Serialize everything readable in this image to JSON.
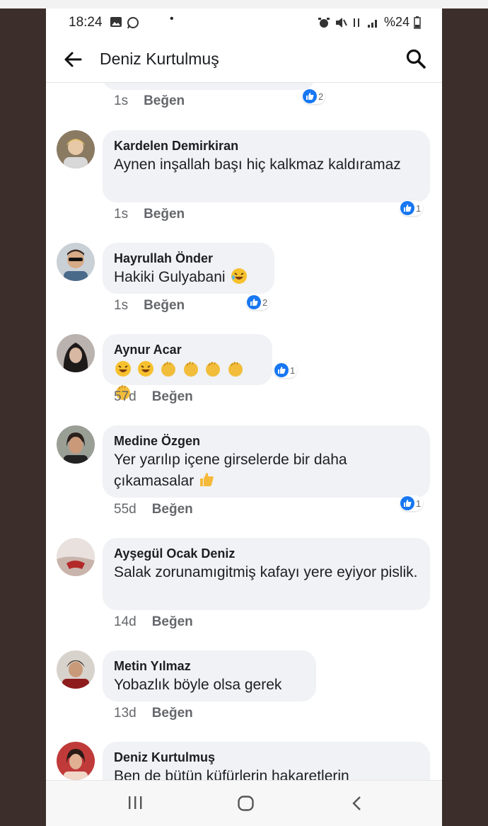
{
  "status_bar": {
    "time": "18:24",
    "battery": "%24"
  },
  "header": {
    "title": "Deniz Kurtulmuş"
  },
  "comments": [
    {
      "author": "",
      "text": "",
      "time": "1s",
      "like": "Beğen",
      "reactions": "2"
    },
    {
      "author": "Kardelen Demirkiran",
      "text": "Aynen inşallah başı hiç kalkmaz kaldıramaz",
      "time": "1s",
      "like": "Beğen",
      "reactions": "1"
    },
    {
      "author": "Hayrullah Önder",
      "text": "Hakiki Gulyabani",
      "time": "1s",
      "like": "Beğen",
      "reactions": "2"
    },
    {
      "author": "Aynur Acar",
      "text": "",
      "time": "57d",
      "like": "Beğen",
      "reactions": "1"
    },
    {
      "author": "Medine Özgen",
      "text": "Yer yarılıp içene girselerde bir daha çıkamasalar",
      "time": "55d",
      "like": "Beğen",
      "reactions": "1"
    },
    {
      "author": "Ayşegül Ocak Deniz",
      "text": "Salak zorunamıgitmiş kafayı yere eyiyor pislik.",
      "time": "14d",
      "like": "Beğen"
    },
    {
      "author": "Metin Yılmaz",
      "text": "Yobazlık böyle olsa gerek",
      "time": "13d",
      "like": "Beğen"
    },
    {
      "author": "Deniz Kurtulmuş",
      "text": "Ben de bütün küfürlerin hakaretlerin"
    }
  ],
  "icons": {
    "back": "arrow-left-icon",
    "search": "search-icon",
    "like_reaction": "thumbs-up-icon",
    "nav_recents": "recents-icon",
    "nav_home": "home-icon",
    "nav_back": "back-icon"
  },
  "colors": {
    "accent": "#1877f2",
    "bubble": "#f0f2f5",
    "meta": "#65676b",
    "backdrop": "#3c2f2b"
  }
}
